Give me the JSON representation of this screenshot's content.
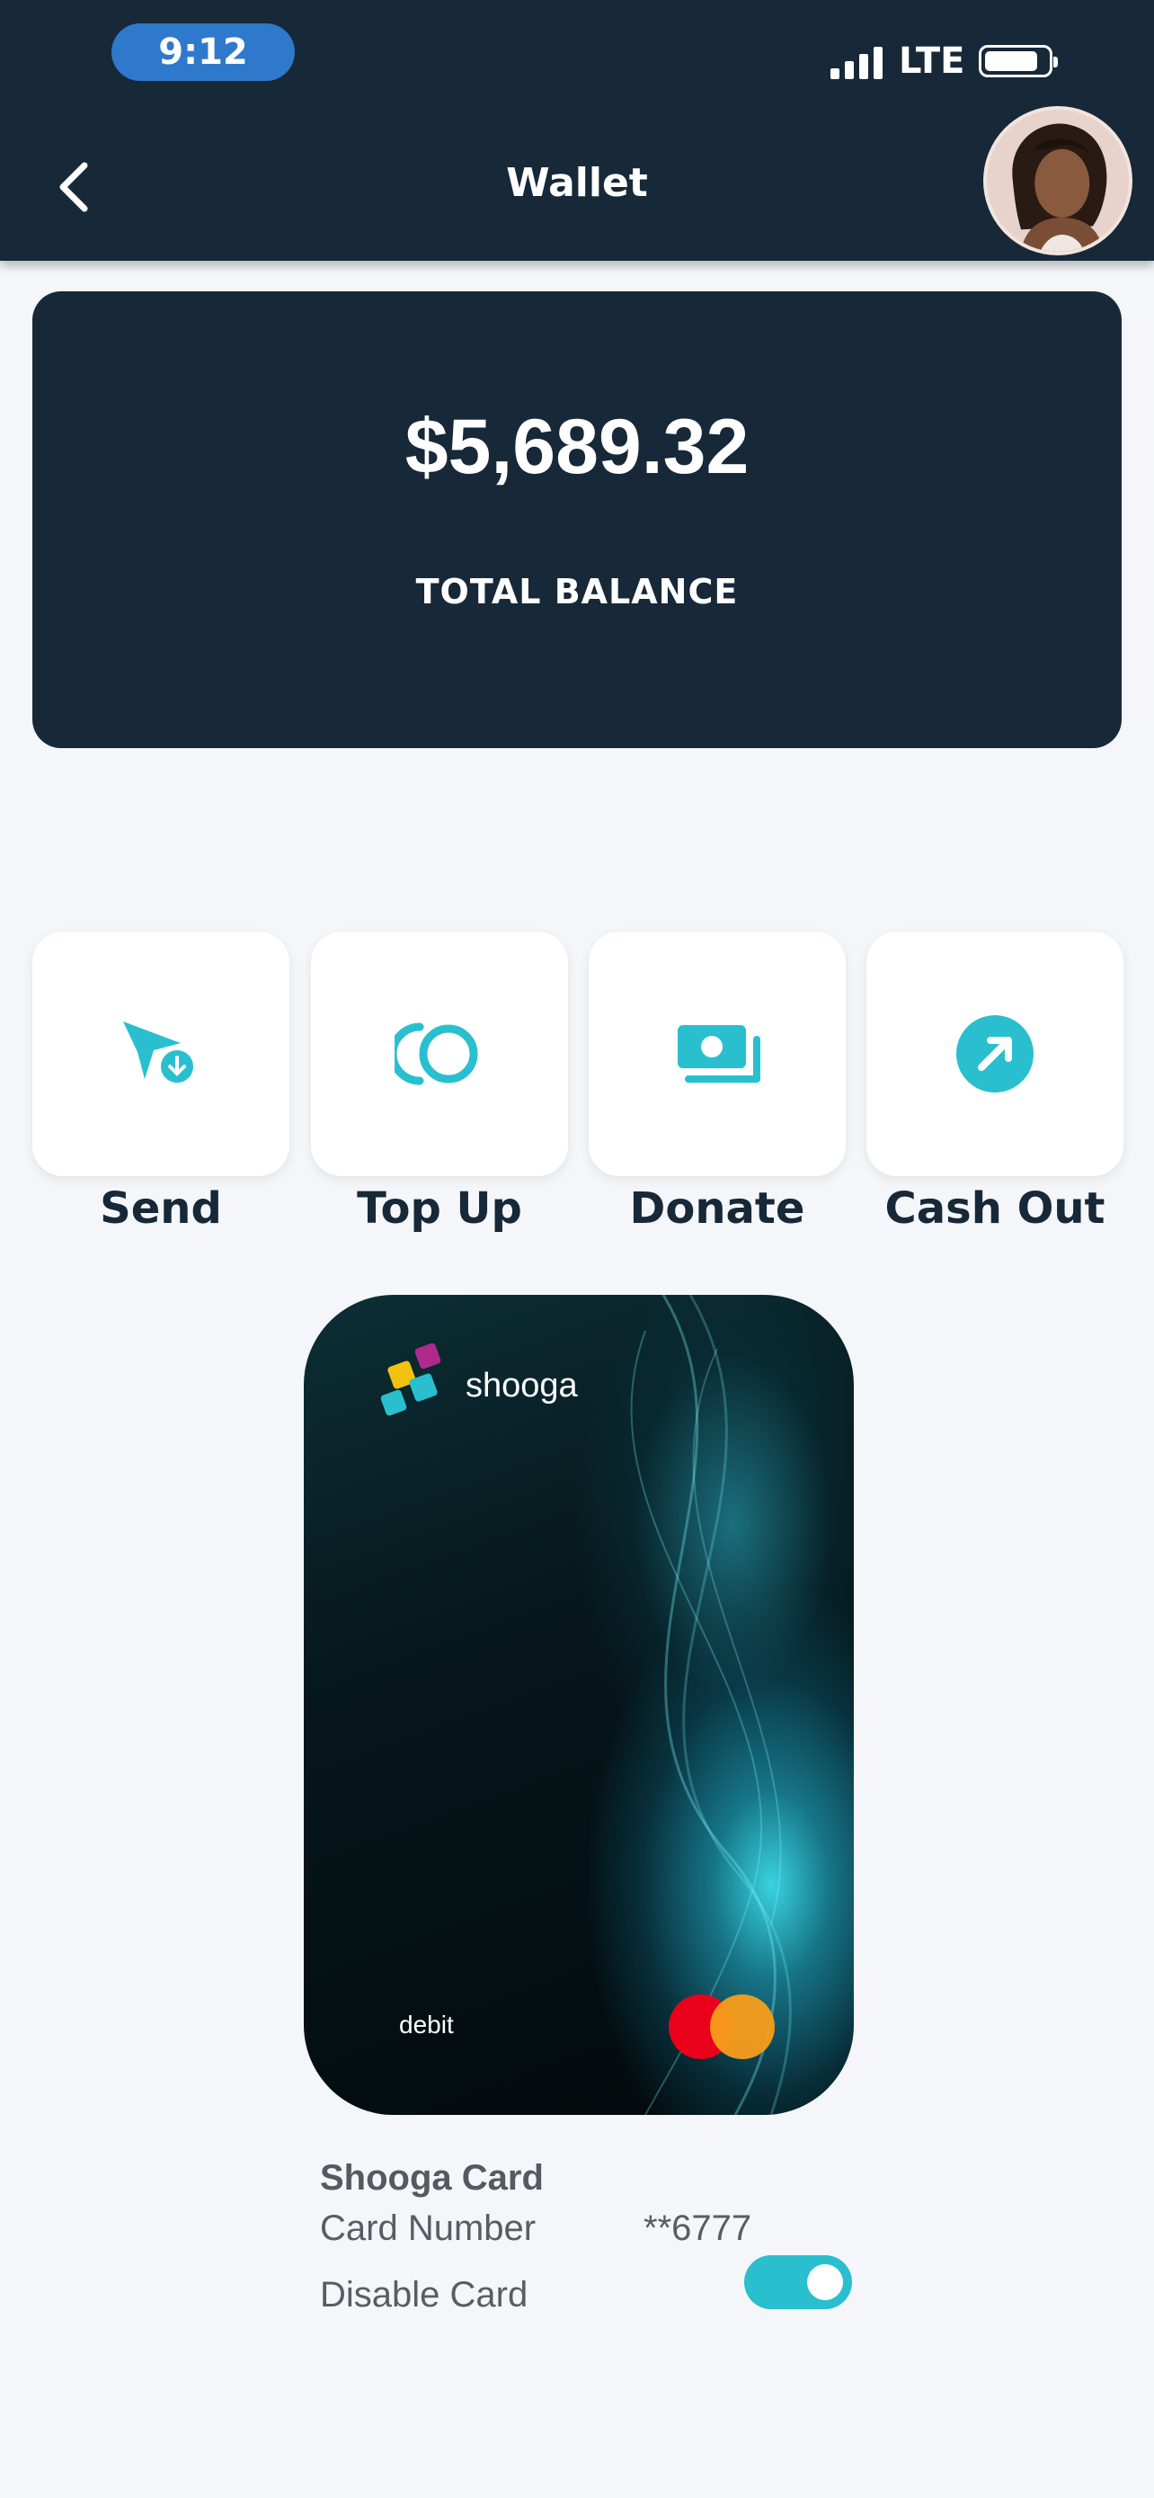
{
  "status_bar": {
    "time": "9:12",
    "network": "LTE"
  },
  "header": {
    "title": "Wallet"
  },
  "balance": {
    "amount": "$5,689.32",
    "label": "TOTAL BALANCE"
  },
  "actions": [
    {
      "label": "Send",
      "icon": "send-icon"
    },
    {
      "label": "Top Up",
      "icon": "top-up-icon"
    },
    {
      "label": "Donate",
      "icon": "donate-icon"
    },
    {
      "label": "Cash Out",
      "icon": "cash-out-icon"
    }
  ],
  "card": {
    "brand": "shooga",
    "type": "debit",
    "network_icon": "mastercard-logo",
    "title": "Shooga Card",
    "number_label": "Card Number",
    "number_value": "**6777",
    "disable_label": "Disable Card",
    "disable_toggle_on": true
  },
  "colors": {
    "navy": "#172838",
    "accent": "#29bfcf",
    "background": "#f4f6f9"
  }
}
